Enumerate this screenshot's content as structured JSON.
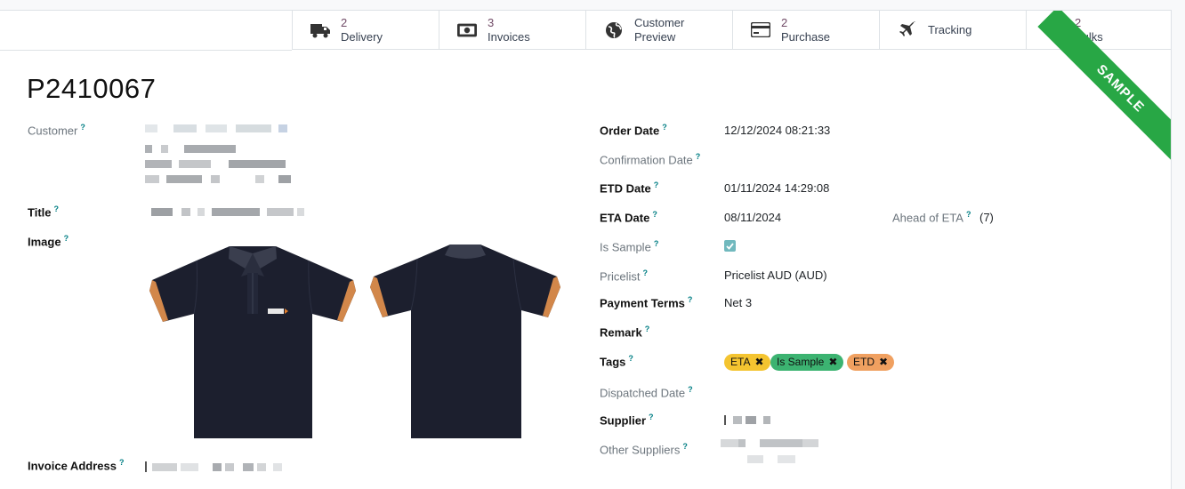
{
  "smart_buttons": [
    {
      "num": "2",
      "label": "Delivery",
      "icon": "truck-icon"
    },
    {
      "num": "3",
      "label": "Invoices",
      "icon": "money-bill-icon"
    },
    {
      "num": "",
      "label": "Customer",
      "label2": "Preview",
      "icon": "globe-icon"
    },
    {
      "num": "2",
      "label": "Purchase",
      "icon": "credit-card-icon"
    },
    {
      "num": "",
      "label": "Tracking",
      "icon": "plane-icon"
    },
    {
      "num": "2",
      "label": "Bulks",
      "icon": "dollar-icon"
    }
  ],
  "ribbon": "SAMPLE",
  "record_title": "P2410067",
  "left": {
    "customer_label": "Customer",
    "title_label": "Title",
    "image_label": "Image",
    "invoice_address_label": "Invoice Address"
  },
  "right": {
    "order_date_label": "Order Date",
    "order_date": "12/12/2024 08:21:33",
    "confirmation_date_label": "Confirmation Date",
    "etd_date_label": "ETD Date",
    "etd_date": "01/11/2024 14:29:08",
    "eta_date_label": "ETA Date",
    "eta_date": "08/11/2024",
    "ahead_label": "Ahead of ETA",
    "ahead_value": "(7)",
    "is_sample_label": "Is Sample",
    "pricelist_label": "Pricelist",
    "pricelist": "Pricelist AUD (AUD)",
    "payment_terms_label": "Payment Terms",
    "payment_terms": "Net 3",
    "remark_label": "Remark",
    "tags_label": "Tags",
    "tags": [
      {
        "name": "ETA",
        "color": "#f4c430"
      },
      {
        "name": "Is Sample",
        "color": "#3cb371"
      },
      {
        "name": "ETD",
        "color": "#f0a060"
      }
    ],
    "dispatched_label": "Dispatched Date",
    "supplier_label": "Supplier",
    "other_suppliers_label": "Other Suppliers"
  },
  "help_mark": "?",
  "colors": {
    "accent": "#714B67",
    "ribbon": "#28a745",
    "shirt": "#1c1f2e",
    "cuff": "#d2874a"
  }
}
